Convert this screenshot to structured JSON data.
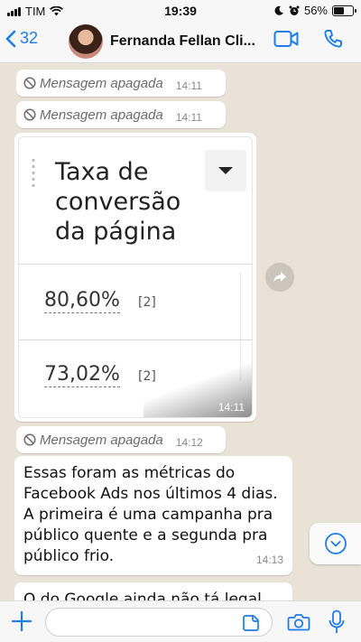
{
  "status_bar": {
    "carrier": "TIM",
    "time": "19:39",
    "battery_percent": "56%",
    "battery_level": 0.56,
    "icons": [
      "signal-icon",
      "wifi-icon",
      "moon-icon",
      "alarm-icon",
      "battery-icon"
    ]
  },
  "header": {
    "back_count": "32",
    "contact_name": "Fernanda Fellan Cli...",
    "icons": [
      "chevron-left-icon",
      "video-call-icon",
      "phone-call-icon"
    ]
  },
  "messages": {
    "deleted_1": {
      "text": "Mensagem apagada",
      "time": "14:11"
    },
    "deleted_2": {
      "text": "Mensagem apagada",
      "time": "14:11"
    },
    "image": {
      "title": "Taxa de\nconversão\nda página",
      "metric_1": "80,60%",
      "metric_1_ref": "[2]",
      "metric_2": "73,02%",
      "metric_2_ref": "[2]",
      "time": "14:11"
    },
    "deleted_3": {
      "text": "Mensagem apagada",
      "time": "14:12"
    },
    "text_1": {
      "text": "Essas foram as métricas do Facebook Ads nos últimos 4 dias. A primeira é uma campanha pra público quente e a segunda pra público frio.",
      "time": "14:13"
    },
    "text_2_partial": {
      "text": "O do Google ainda não tá legal,"
    }
  },
  "input": {
    "placeholder": "",
    "value": ""
  },
  "colors": {
    "accent": "#1e7ce8",
    "chat_bg": "#e9e2d7",
    "bubble": "#ffffff"
  }
}
